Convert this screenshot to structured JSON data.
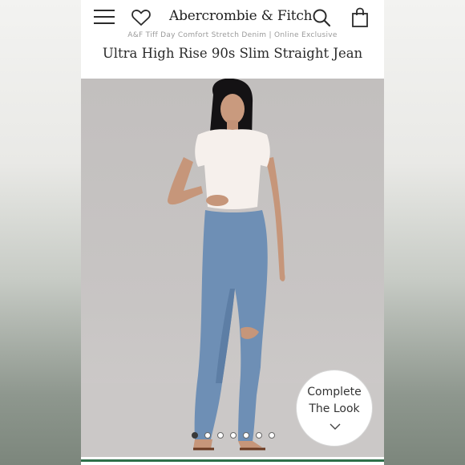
{
  "header": {
    "brand": "Abercrombie & Fitch",
    "icons": [
      "menu-icon",
      "heart-icon",
      "search-icon",
      "shopping-bag-icon"
    ]
  },
  "product": {
    "collection": "A&F Tiff Day Comfort Stretch Denim | Online Exclusive",
    "title": "Ultra High Rise 90s Slim Straight Jean"
  },
  "gallery": {
    "image": "model wearing white cropped tee and medium wash high rise slim straight jeans with ripped knee",
    "dot_count": 7,
    "active_index": 0
  },
  "complete_look": {
    "line1": "Complete",
    "line2": "The Look"
  },
  "colors": {
    "accent_green": "#2f6f4a",
    "text_dark": "#2a2a2a",
    "image_bg": "#c4c1c0"
  }
}
